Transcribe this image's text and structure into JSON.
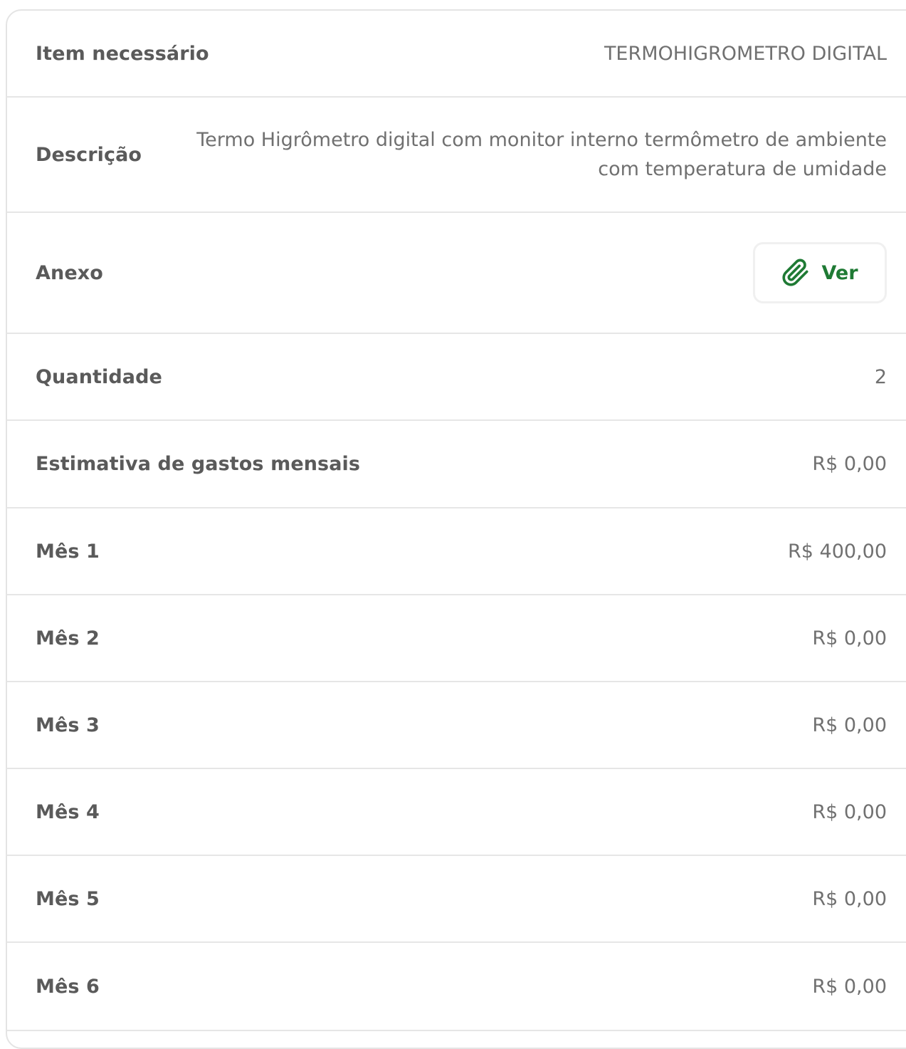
{
  "item": {
    "label": "Item necessário",
    "value": "TERMOHIGROMETRO DIGITAL"
  },
  "descricao": {
    "label": "Descrição",
    "value": "Termo Higrômetro digital com monitor interno termômetro de ambiente com temperatura de umidade"
  },
  "anexo": {
    "label": "Anexo",
    "button_label": "Ver",
    "icon": "paperclip-icon",
    "accent_color": "#1f7a34"
  },
  "quantidade": {
    "label": "Quantidade",
    "value": "2"
  },
  "estimativa": {
    "label": "Estimativa de gastos mensais",
    "value": "R$ 0,00"
  },
  "meses": [
    {
      "label": "Mês 1",
      "value": "R$ 400,00"
    },
    {
      "label": "Mês 2",
      "value": "R$ 0,00"
    },
    {
      "label": "Mês 3",
      "value": "R$ 0,00"
    },
    {
      "label": "Mês 4",
      "value": "R$ 0,00"
    },
    {
      "label": "Mês 5",
      "value": "R$ 0,00"
    },
    {
      "label": "Mês 6",
      "value": "R$ 0,00"
    }
  ]
}
